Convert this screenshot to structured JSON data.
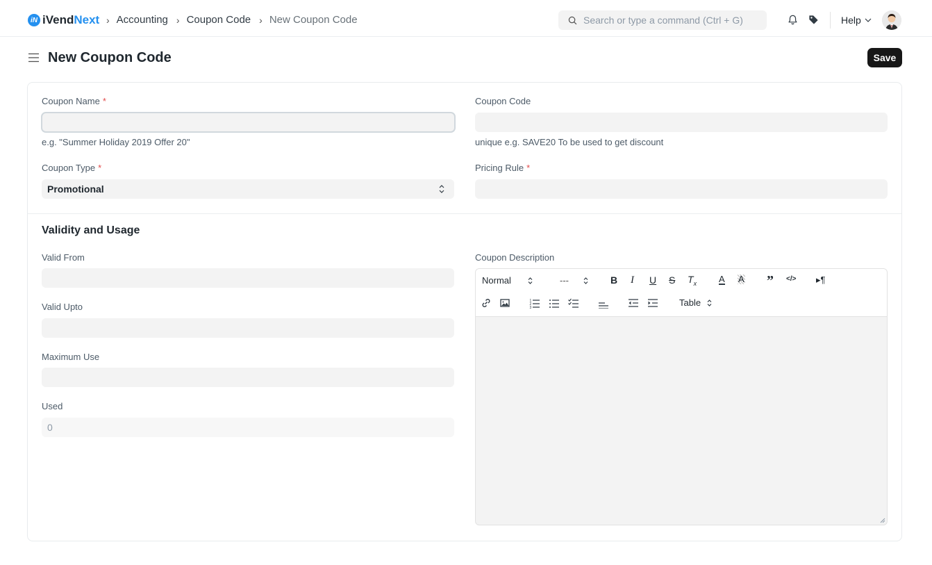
{
  "navbar": {
    "logo_prefix": "iVend",
    "logo_suffix": "Next",
    "logo_mark": "iN",
    "breadcrumbs": [
      "Accounting",
      "Coupon Code",
      "New Coupon Code"
    ],
    "search_placeholder": "Search or type a command (Ctrl + G)",
    "help_label": "Help",
    "icons": [
      "search-icon",
      "bell-icon",
      "tag-icon",
      "chevron-down-icon",
      "user-avatar"
    ]
  },
  "page": {
    "title": "New Coupon Code",
    "save_label": "Save"
  },
  "form": {
    "coupon_name": {
      "label": "Coupon Name",
      "required": "*",
      "value": "",
      "help": "e.g. \"Summer Holiday 2019 Offer 20\""
    },
    "coupon_code": {
      "label": "Coupon Code",
      "value": "",
      "help": "unique e.g. SAVE20 To be used to get discount"
    },
    "coupon_type": {
      "label": "Coupon Type",
      "required": "*",
      "value": "Promotional"
    },
    "pricing_rule": {
      "label": "Pricing Rule",
      "required": "*",
      "value": ""
    },
    "section_title": "Validity and Usage",
    "valid_from": {
      "label": "Valid From",
      "value": ""
    },
    "valid_upto": {
      "label": "Valid Upto",
      "value": ""
    },
    "maximum_use": {
      "label": "Maximum Use",
      "value": ""
    },
    "used": {
      "label": "Used",
      "value": "0"
    },
    "coupon_description": {
      "label": "Coupon Description"
    }
  },
  "editor": {
    "format_select": "Normal",
    "size_select": "---",
    "table_label": "Table"
  },
  "colors": {
    "accent": "#2490ef",
    "required": "#e24c4c",
    "save_bg": "#171717",
    "field_bg": "#f3f3f3"
  }
}
